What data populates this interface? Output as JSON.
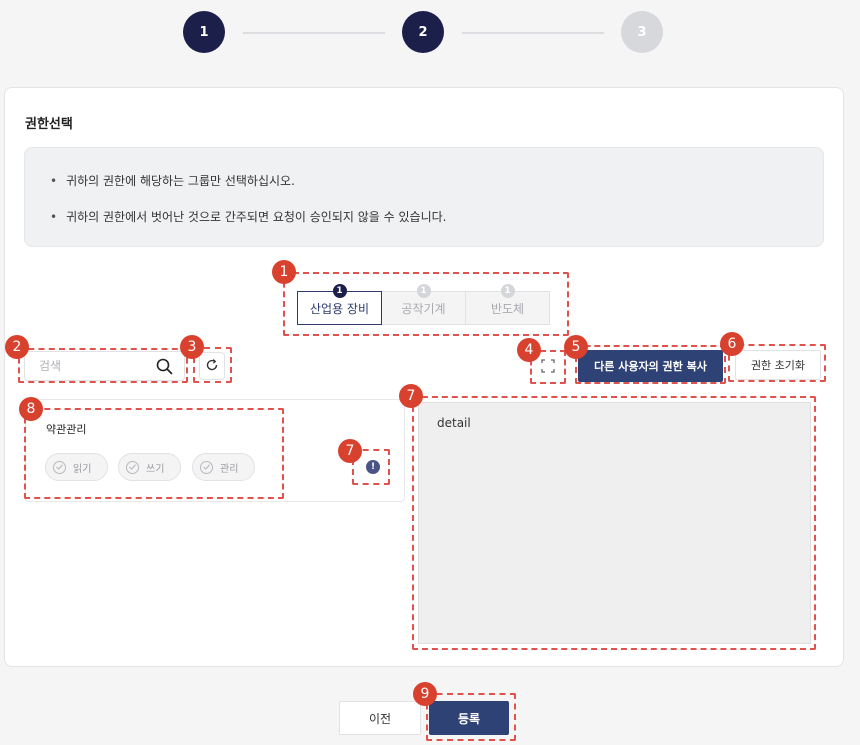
{
  "stepper": {
    "steps": [
      {
        "label": "1",
        "state": "done"
      },
      {
        "label": "2",
        "state": "current"
      },
      {
        "label": "3",
        "state": "pending"
      }
    ]
  },
  "section": {
    "title": "권한선택"
  },
  "notice": {
    "items": [
      "귀하의 권한에 해당하는 그룹만 선택하십시오.",
      "귀하의 권한에서 벗어난 것으로 간주되면 요청이 승인되지 않을 수 있습니다."
    ]
  },
  "tabs": [
    {
      "num": "1",
      "label": "산업용 장비",
      "active": true
    },
    {
      "num": "1",
      "label": "공작기계",
      "active": false
    },
    {
      "num": "1",
      "label": "반도체",
      "active": false
    }
  ],
  "search": {
    "placeholder": "검색"
  },
  "toolbar": {
    "copy_label": "다른 사용자의 권한 복사",
    "reset_label": "권한 초기화"
  },
  "group": {
    "title": "약관관리",
    "permissions": [
      "읽기",
      "쓰기",
      "관리"
    ]
  },
  "detail": {
    "text": "detail"
  },
  "footer": {
    "prev_label": "이전",
    "submit_label": "등록"
  },
  "annotations": [
    "1",
    "2",
    "3",
    "4",
    "5",
    "6",
    "7",
    "7",
    "8",
    "9"
  ],
  "colors": {
    "primary": "#2f4275",
    "step_active": "#1c1f4a",
    "annotation": "#e0524b"
  }
}
